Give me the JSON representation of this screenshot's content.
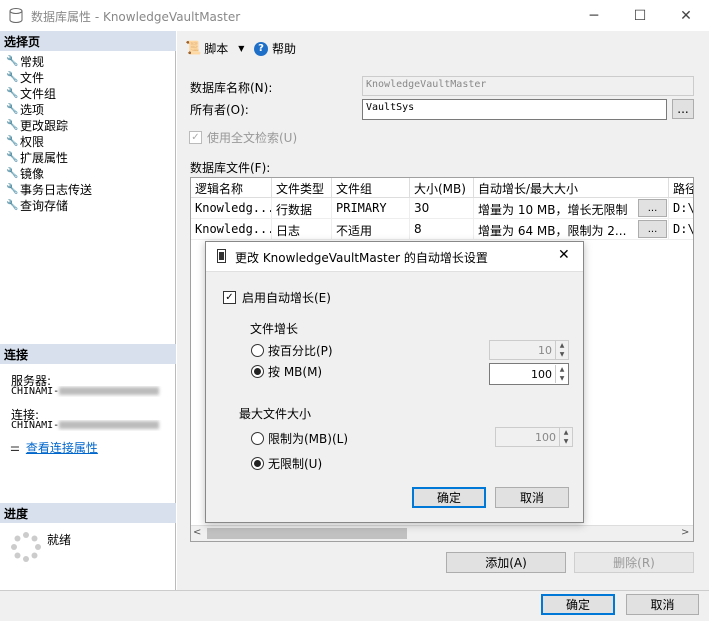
{
  "window": {
    "title": "数据库属性 - KnowledgeVaultMaster",
    "minimize": "─",
    "maximize": "☐",
    "close": "✕"
  },
  "left": {
    "select_page_header": "选择页",
    "pages": [
      "常规",
      "文件",
      "文件组",
      "选项",
      "更改跟踪",
      "权限",
      "扩展属性",
      "镜像",
      "事务日志传送",
      "查询存储"
    ],
    "connection_header": "连接",
    "server_label": "服务器:",
    "server_value": "CHINAMI-",
    "connection_label": "连接:",
    "connection_value": "CHINAMI-",
    "view_conn_link": "查看连接属性",
    "progress_header": "进度",
    "progress_status": "就绪"
  },
  "toolbar": {
    "script_label": "脚本",
    "help_label": "帮助"
  },
  "form": {
    "db_name_label": "数据库名称(N):",
    "db_name_value": "KnowledgeVaultMaster",
    "owner_label": "所有者(O):",
    "owner_value": "VaultSys",
    "browse_label": "...",
    "fulltext_label": "使用全文检索(U)",
    "fulltext_check": "✓",
    "files_label": "数据库文件(F):"
  },
  "grid": {
    "headers": [
      "逻辑名称",
      "文件类型",
      "文件组",
      "大小(MB)",
      "自动增长/最大大小",
      "路径"
    ],
    "rows": [
      {
        "name": "Knowledg...",
        "type": "行数据",
        "group": "PRIMARY",
        "size": "30",
        "growth": "增量为 10 MB，增长无限制",
        "btn": "...",
        "path": "D:\\"
      },
      {
        "name": "Knowledg...",
        "type": "日志",
        "group": "不适用",
        "size": "8",
        "growth": "增量为 64 MB，限制为 2...",
        "btn": "...",
        "path": "D:\\"
      }
    ],
    "scroll_left": "<",
    "scroll_right": ">"
  },
  "actions": {
    "add": "添加(A)",
    "remove": "删除(R)"
  },
  "footer": {
    "ok": "确定",
    "cancel": "取消"
  },
  "dialog": {
    "title": "更改 KnowledgeVaultMaster 的自动增长设置",
    "close": "✕",
    "enable_label": "启用自动增长(E)",
    "enable_check": "✓",
    "file_growth_label": "文件增长",
    "percent_label": "按百分比(P)",
    "percent_value": "10",
    "mb_label": "按 MB(M)",
    "mb_value": "100",
    "max_size_label": "最大文件大小",
    "limit_label": "限制为(MB)(L)",
    "limit_value": "100",
    "unlimited_label": "无限制(U)",
    "ok": "确定",
    "cancel": "取消",
    "selected_growth": "mb",
    "selected_max": "unlimited"
  },
  "colors": {
    "accent": "#0078d7",
    "header_bg": "#d7e0ec",
    "link": "#0066cc"
  }
}
